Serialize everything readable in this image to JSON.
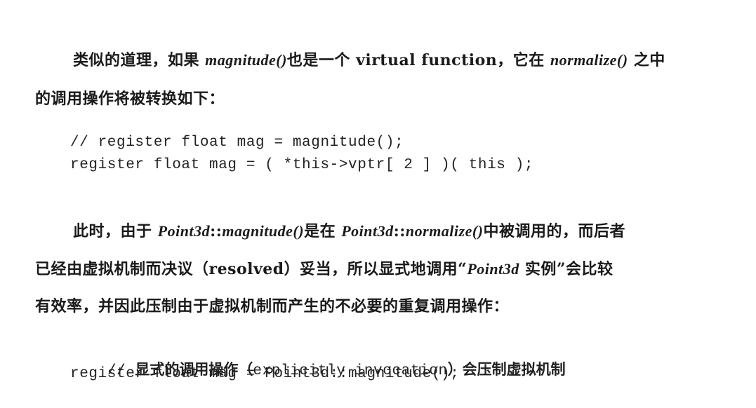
{
  "paragraph1": {
    "line1": {
      "t1": "类似的道理，如果 ",
      "i1": "magnitude()",
      "t2": "也是一个 virtual function，它在 ",
      "i2": "normalize()",
      "t3": " 之中"
    },
    "line2": "的调用操作将被转换如下："
  },
  "code1": {
    "line1": "// register float mag = magnitude();",
    "line2": "register float mag = ( *this->vptr[ 2 ] )( this );"
  },
  "paragraph2": {
    "line1": {
      "t1": "此时，由于 ",
      "i1": "Point3d",
      "t2": "::",
      "i2": "magnitude()",
      "t3": "是在 ",
      "i3": "Point3d",
      "t4": "::",
      "i4": "normalize()",
      "t5": "中被调用的，而后者"
    },
    "line2": {
      "t1": "已经由虚拟机制而决议（resolved）妥当，所以显式地调用“",
      "i1": "Point3d",
      "t2": " 实例”会比较"
    },
    "line3": "有效率，并因此压制由于虚拟机制而产生的不必要的重复调用操作："
  },
  "code2": {
    "line1": {
      "prefix": "// ",
      "cjk1": "显式的调用操作（",
      "mid": "explicitly invocation",
      "cjk2": "）会压制虚拟机制"
    },
    "line2": "register float mag = Point3d::magnitude();"
  }
}
